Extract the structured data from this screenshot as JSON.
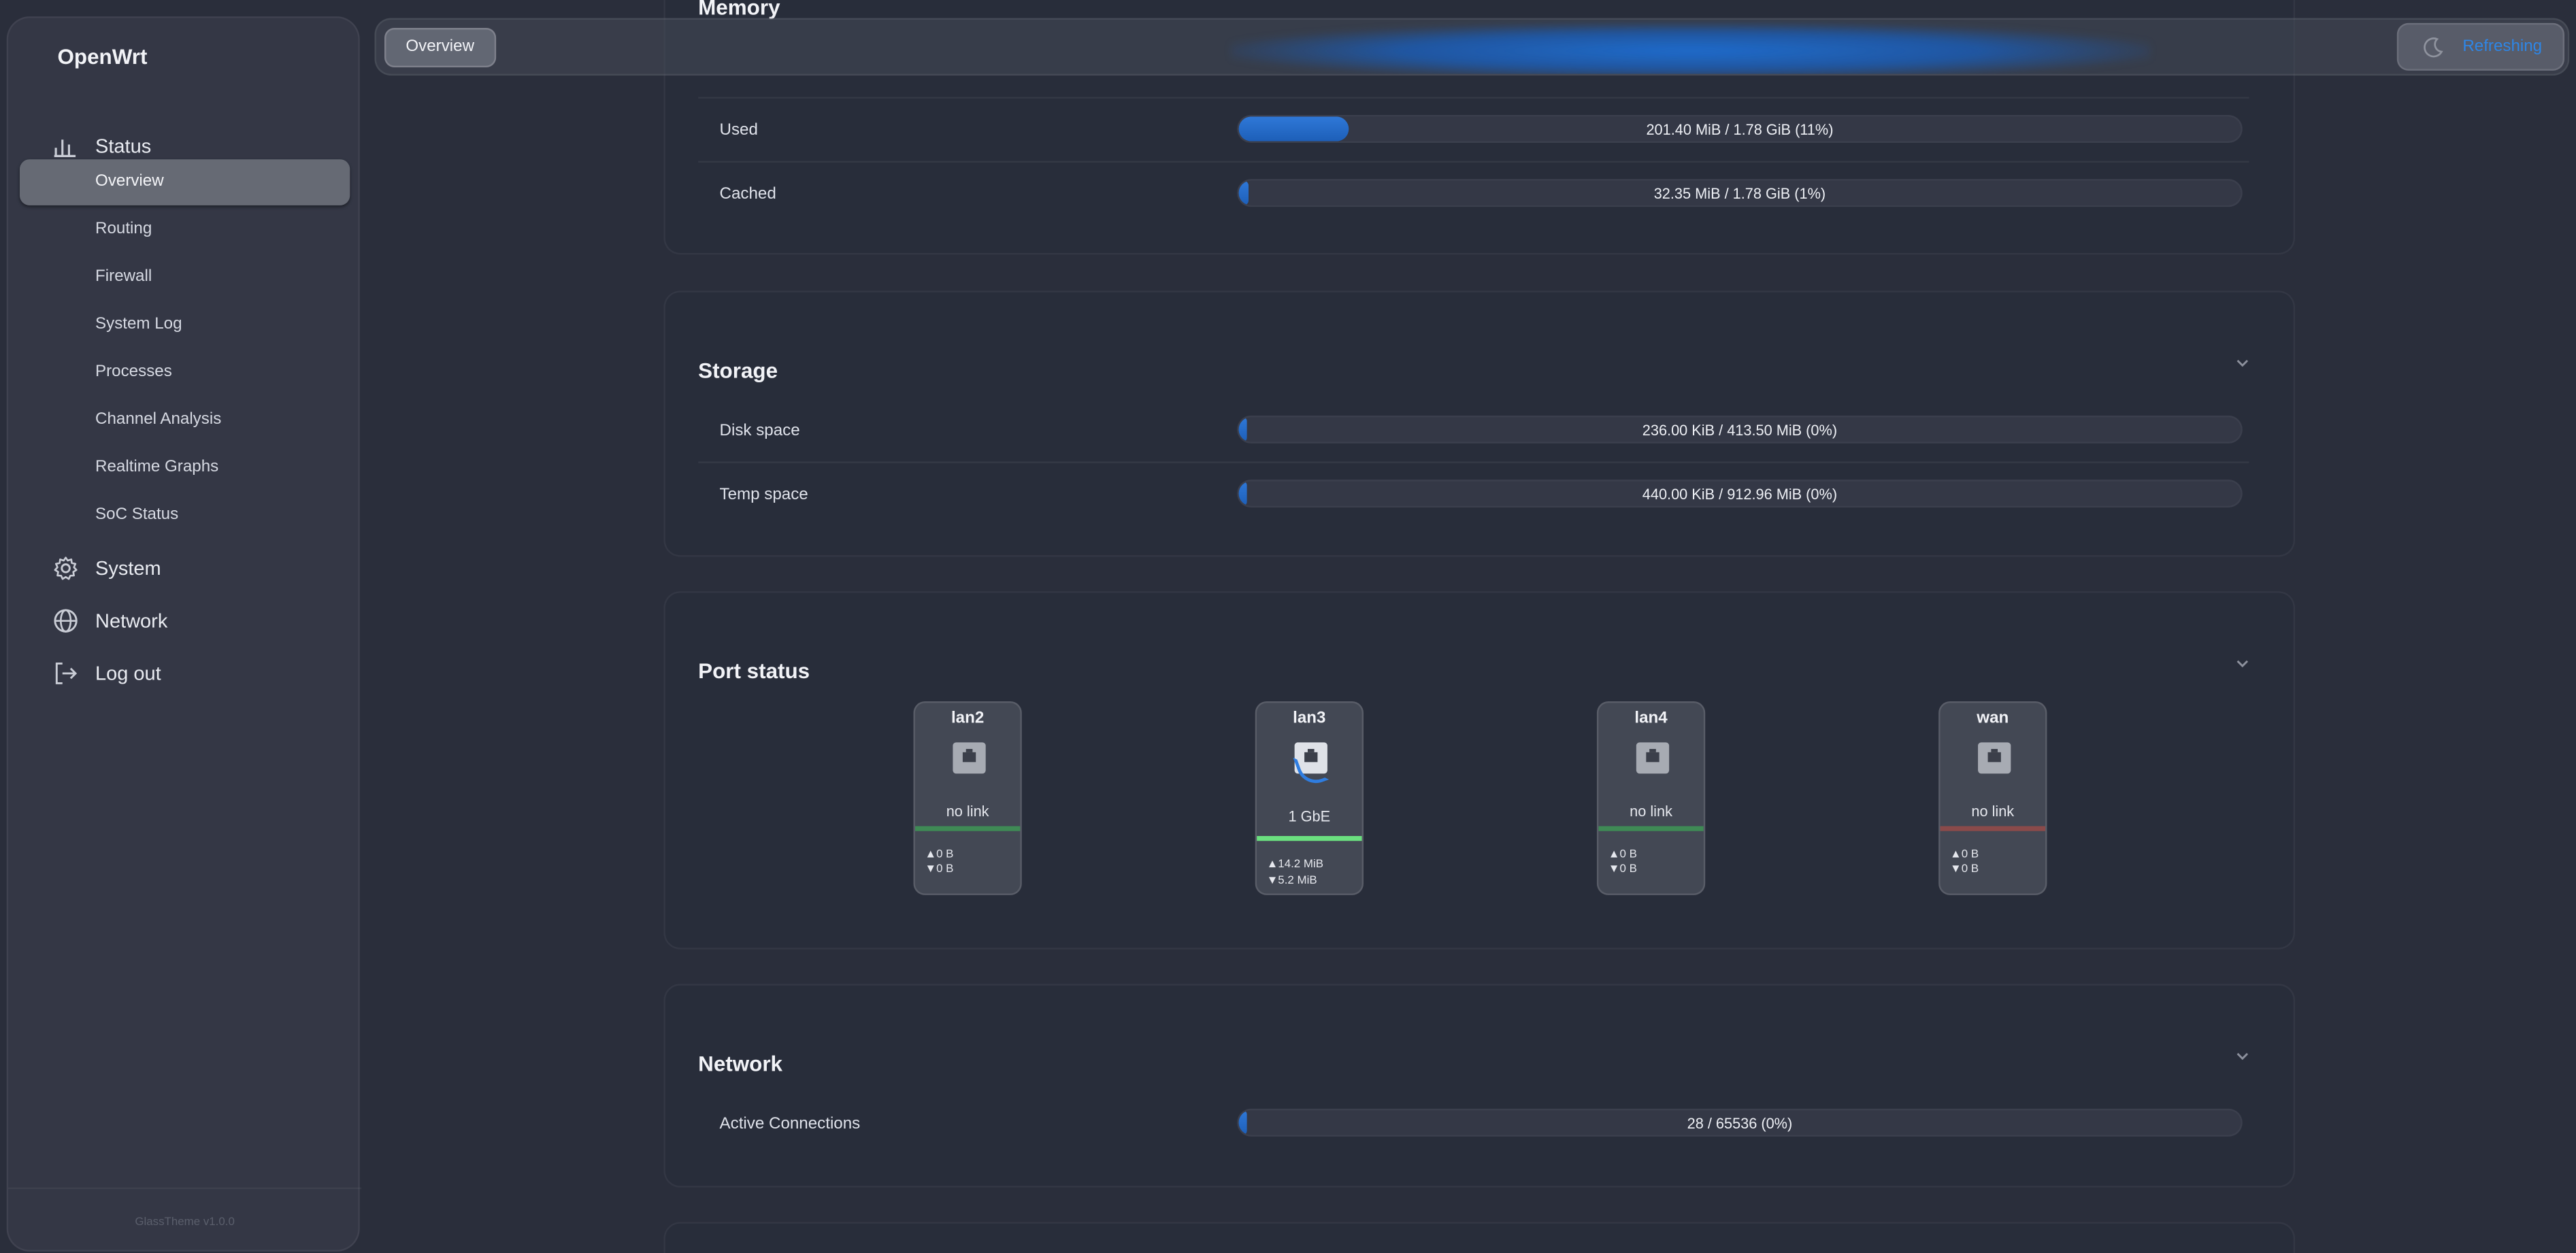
{
  "app": {
    "title": "OpenWrt",
    "version": "GlassTheme v1.0.0"
  },
  "sidebar": {
    "status_label": "Status",
    "status_items": [
      "Overview",
      "Routing",
      "Firewall",
      "System Log",
      "Processes",
      "Channel Analysis",
      "Realtime Graphs",
      "SoC Status"
    ],
    "active_item": "Overview",
    "system_label": "System",
    "network_label": "Network",
    "logout_label": "Log out"
  },
  "topbar": {
    "breadcrumb": "Overview",
    "refresh_label": "Refreshing"
  },
  "memory": {
    "title": "Memory",
    "rows": [
      {
        "label": "Used",
        "value": "201.40 MiB / 1.78 GiB (11%)",
        "percent": 11
      },
      {
        "label": "Cached",
        "value": "32.35 MiB / 1.78 GiB (1%)",
        "percent": 1
      }
    ]
  },
  "storage": {
    "title": "Storage",
    "rows": [
      {
        "label": "Disk space",
        "value": "236.00 KiB / 413.50 MiB (0%)",
        "percent": 0
      },
      {
        "label": "Temp space",
        "value": "440.00 KiB / 912.96 MiB (0%)",
        "percent": 0
      }
    ]
  },
  "ports": {
    "title": "Port status",
    "items": [
      {
        "name": "lan2",
        "status": "no link",
        "tx": "▲0 B",
        "rx": "▼0 B",
        "line_color": "#3f8a55",
        "linked": false
      },
      {
        "name": "lan3",
        "status": "1 GbE",
        "tx": "▲14.2 MiB",
        "rx": "▼5.2 MiB",
        "line_color": "#6be07f",
        "linked": true
      },
      {
        "name": "lan4",
        "status": "no link",
        "tx": "▲0 B",
        "rx": "▼0 B",
        "line_color": "#3f8a55",
        "linked": false
      },
      {
        "name": "wan",
        "status": "no link",
        "tx": "▲0 B",
        "rx": "▼0 B",
        "line_color": "#8a4a4a",
        "linked": false
      }
    ]
  },
  "network": {
    "title": "Network",
    "rows": [
      {
        "label": "Active Connections",
        "value": "28 / 65536 (0%)",
        "percent": 0
      }
    ]
  }
}
